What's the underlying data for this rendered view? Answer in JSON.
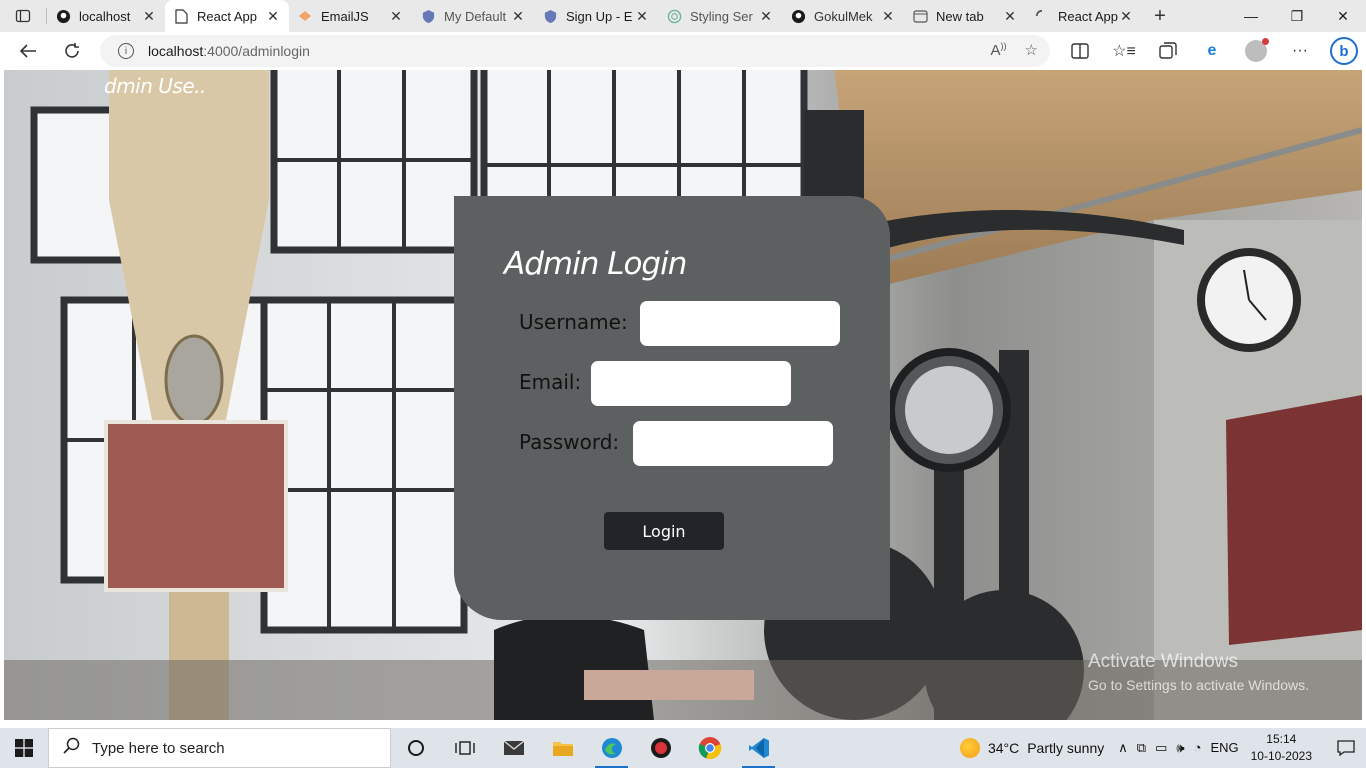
{
  "browser": {
    "tabs": [
      {
        "title": "localhost",
        "icon": "github-icon",
        "active": false
      },
      {
        "title": "React App",
        "icon": "page-icon",
        "active": true
      },
      {
        "title": "EmailJS",
        "icon": "emailjs-icon",
        "active": false
      },
      {
        "title": "My Default",
        "icon": "shield-icon",
        "active": false
      },
      {
        "title": "Sign Up - E",
        "icon": "shield-icon",
        "active": false
      },
      {
        "title": "Styling Ser",
        "icon": "globe-icon",
        "active": false
      },
      {
        "title": "GokulMek",
        "icon": "github-icon",
        "active": false
      },
      {
        "title": "New tab",
        "icon": "newtab-icon",
        "active": false
      },
      {
        "title": "React App",
        "icon": "loading-icon",
        "active": false
      }
    ],
    "url_host": "localhost",
    "url_path": ":4000/adminlogin"
  },
  "page": {
    "welcome_text": "dmin Use..",
    "form_title": "Admin Login",
    "username_label": "Username:",
    "email_label": "Email:",
    "password_label": "Password:",
    "username_value": "",
    "email_value": "",
    "password_value": "",
    "login_label": "Login"
  },
  "watermark": {
    "title": "Activate Windows",
    "subtitle": "Go to Settings to activate Windows."
  },
  "taskbar": {
    "search_placeholder": "Type here to search",
    "weather_temp": "34°C",
    "weather_desc": "Partly sunny",
    "language": "ENG",
    "time": "15:14",
    "date": "10-10-2023"
  },
  "colors": {
    "card_bg": "#5d6061",
    "login_button": "#212529",
    "taskbar_bg": "#dfe4ea"
  }
}
